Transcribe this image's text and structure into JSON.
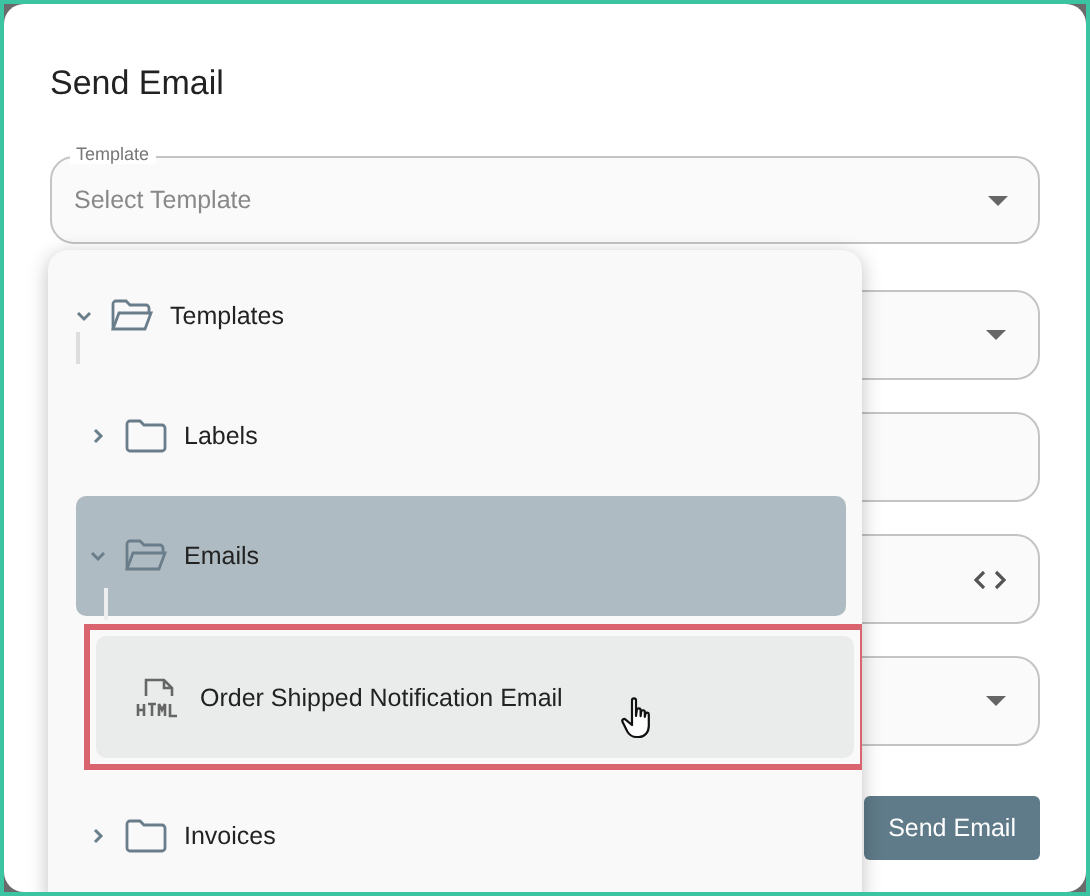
{
  "dialog": {
    "title": "Send Email"
  },
  "template_field": {
    "label": "Template",
    "placeholder": "Select Template"
  },
  "background_fields": [
    {
      "kind": "select"
    },
    {
      "kind": "text"
    },
    {
      "kind": "code"
    },
    {
      "kind": "select"
    }
  ],
  "send_button": {
    "label": "Send Email"
  },
  "tree": [
    {
      "kind": "folder",
      "label": "Templates",
      "expanded": true,
      "selected": false,
      "hovered": false,
      "children": [
        {
          "kind": "folder",
          "label": "Labels",
          "expanded": false,
          "selected": false,
          "hovered": false
        },
        {
          "kind": "folder",
          "label": "Emails",
          "expanded": true,
          "selected": true,
          "hovered": false,
          "children": [
            {
              "kind": "html",
              "label": "Order Shipped Notification Email",
              "selected": false,
              "hovered": true
            }
          ]
        },
        {
          "kind": "folder",
          "label": "Invoices",
          "expanded": false,
          "selected": false,
          "hovered": false
        }
      ]
    }
  ]
}
